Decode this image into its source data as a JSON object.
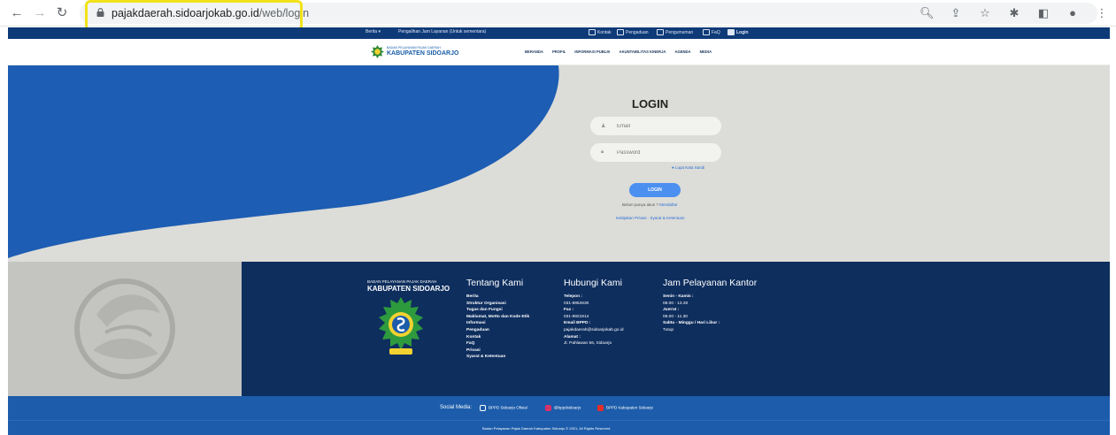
{
  "browser": {
    "url_domain": "pajakdaerah.sidoarjokab.go.id",
    "url_path": "/web/login"
  },
  "topbar": {
    "left": [
      "Berita",
      "Pengalihan Jam Layanan (Untuk sementara)"
    ],
    "right": [
      "Kontak",
      "Pengaduan",
      "Pengumuman",
      "FaQ",
      "Login"
    ]
  },
  "brand": {
    "small": "BADAN PELAYANAN PAJAK DAERAH",
    "main": "KABUPATEN SIDOARJO"
  },
  "menu": [
    "BERANDA",
    "PROFIL",
    "INFORMASI PUBLIK",
    "AKUNTABILITAS KINERJA",
    "AGENDA",
    "MEDIA"
  ],
  "login": {
    "title": "LOGIN",
    "email_placeholder": "Email",
    "password_placeholder": "Password",
    "forgot": "Lupa Kata Sandi",
    "button": "LOGIN",
    "register_prefix": "Belum punya akun ?",
    "register_link": "Mendaftar",
    "policy": "Kebijakan Privasi · Syarat & Ketentuan"
  },
  "footer": {
    "brand_small": "BADAN PELAYANAN PAJAK DAERAH",
    "brand_main": "KABUPATEN SIDOARJO",
    "tentang": {
      "title": "Tentang Kami",
      "items": [
        "Berita",
        "Struktur Organisasi",
        "Tugas dan Fungsi",
        "Maklumat, Motto dan Kode Etik",
        "Informasi",
        "Pengaduan",
        "Kontak",
        "FaQ",
        "Privasi",
        "Syarat & Ketentuan"
      ]
    },
    "hubungi": {
      "title": "Hubungi Kami",
      "telepon_label": "Telepon :",
      "telepon": "031-8952630",
      "fax_label": "Fax :",
      "fax": "031-8921914",
      "email_label": "Email BPPD :",
      "email": "pajakdaerah@sidoarjokab.go.id",
      "alamat_label": "Alamat :",
      "alamat": "Jl. Pahlawan 56, Sidoarjo"
    },
    "jam": {
      "title": "Jam Pelayanan Kantor",
      "senin_label": "Senin - Kamis :",
      "senin": "08.00 - 13.30",
      "jumat_label": "Jum'at :",
      "jumat": "08.00 - 11.30",
      "sabtu_label": "Sabtu - Minggu / Hari Libur :",
      "sabtu": "Tutup"
    }
  },
  "social": {
    "label": "Social Media:",
    "facebook": "BPPD Sidoarjo Ofisial",
    "instagram": "@bppdsidoarjo",
    "youtube": "BPPD Kabupaten Sidoarjo"
  },
  "copyright": "Badan Pelayanan Pajak Daerah Kabupaten Sidoarjo © 2021, All Rights Reserved",
  "colors": {
    "primary": "#0e3a78",
    "hero_blue": "#1d5db3",
    "hero_grey": "#dcdcd8",
    "button": "#4b8ff0",
    "highlight": "#f2e21a"
  }
}
